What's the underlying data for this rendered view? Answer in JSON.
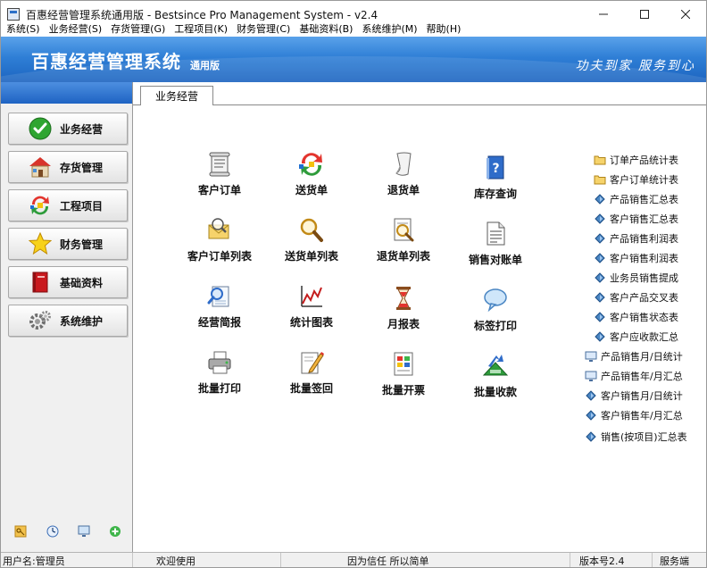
{
  "window": {
    "title": "百惠经营管理系统通用版 - Bestsince Pro Management System - v2.4",
    "controls": [
      "minimize-icon",
      "maximize-icon",
      "close-icon"
    ]
  },
  "menu": [
    "系统(S)",
    "业务经营(S)",
    "存货管理(G)",
    "工程项目(K)",
    "财务管理(C)",
    "基础资料(B)",
    "系统维护(M)",
    "帮助(H)"
  ],
  "banner": {
    "title": "百惠经营管理系统",
    "edition": "通用版",
    "slogan": "功夫到家 服务到心"
  },
  "sidebar": {
    "items": [
      {
        "label": "业务经营",
        "icon": "check-circle-icon"
      },
      {
        "label": "存货管理",
        "icon": "house-icon"
      },
      {
        "label": "工程项目",
        "icon": "recycle-arrows-icon"
      },
      {
        "label": "财务管理",
        "icon": "star-icon"
      },
      {
        "label": "基础资料",
        "icon": "book-icon"
      },
      {
        "label": "系统维护",
        "icon": "gears-icon"
      }
    ],
    "bottom_icons": [
      "key-icon",
      "clock-icon",
      "monitor-icon",
      "plus-circle-icon"
    ]
  },
  "main": {
    "tab": "业务经营",
    "modules": [
      {
        "label": "客户订单",
        "icon": "scroll-document-icon"
      },
      {
        "label": "送货单",
        "icon": "recycle-arrows-icon"
      },
      {
        "label": "退货单",
        "icon": "curled-paper-icon"
      },
      {
        "label": "库存查询",
        "icon": "help-book-icon"
      },
      {
        "label": "客户订单列表",
        "icon": "envelope-search-icon"
      },
      {
        "label": "送货单列表",
        "icon": "magnifier-icon"
      },
      {
        "label": "退货单列表",
        "icon": "document-magnifier-icon"
      },
      {
        "label": "销售对账单",
        "icon": "document-lines-icon"
      },
      {
        "label": "经营简报",
        "icon": "report-magnifier-icon"
      },
      {
        "label": "统计图表",
        "icon": "line-chart-icon"
      },
      {
        "label": "月报表",
        "icon": "hourglass-icon"
      },
      {
        "label": "标签打印",
        "icon": "speech-bubble-icon"
      },
      {
        "label": "批量打印",
        "icon": "printer-icon"
      },
      {
        "label": "批量签回",
        "icon": "pencil-document-icon"
      },
      {
        "label": "批量开票",
        "icon": "invoice-icon"
      },
      {
        "label": "批量收款",
        "icon": "money-arrow-icon"
      }
    ],
    "reports": [
      {
        "label": "订单产品统计表",
        "icon": "folder-icon"
      },
      {
        "label": "客户订单统计表",
        "icon": "folder-icon"
      },
      {
        "label": "产品销售汇总表",
        "icon": "diamond-icon"
      },
      {
        "label": "客户销售汇总表",
        "icon": "diamond-icon"
      },
      {
        "label": "产品销售利润表",
        "icon": "diamond-icon"
      },
      {
        "label": "客户销售利润表",
        "icon": "diamond-icon"
      },
      {
        "label": "业务员销售提成",
        "icon": "diamond-icon"
      },
      {
        "label": "客户产品交叉表",
        "icon": "diamond-icon"
      },
      {
        "label": "客户销售状态表",
        "icon": "diamond-icon"
      },
      {
        "label": "客户应收款汇总",
        "icon": "diamond-icon"
      },
      {
        "label": "产品销售月/日统计",
        "icon": "screen-icon"
      },
      {
        "label": "产品销售年/月汇总",
        "icon": "screen-icon"
      },
      {
        "label": "客户销售月/日统计",
        "icon": "diamond-icon"
      },
      {
        "label": "客户销售年/月汇总",
        "icon": "diamond-icon"
      },
      {
        "label": "销售(按项目)汇总表",
        "icon": "diamond-icon"
      }
    ]
  },
  "status": {
    "user": "用户名:管理员",
    "welcome": "欢迎使用",
    "motto": "因为信任 所以简单",
    "version": "版本号2.4",
    "server": "服务端"
  }
}
